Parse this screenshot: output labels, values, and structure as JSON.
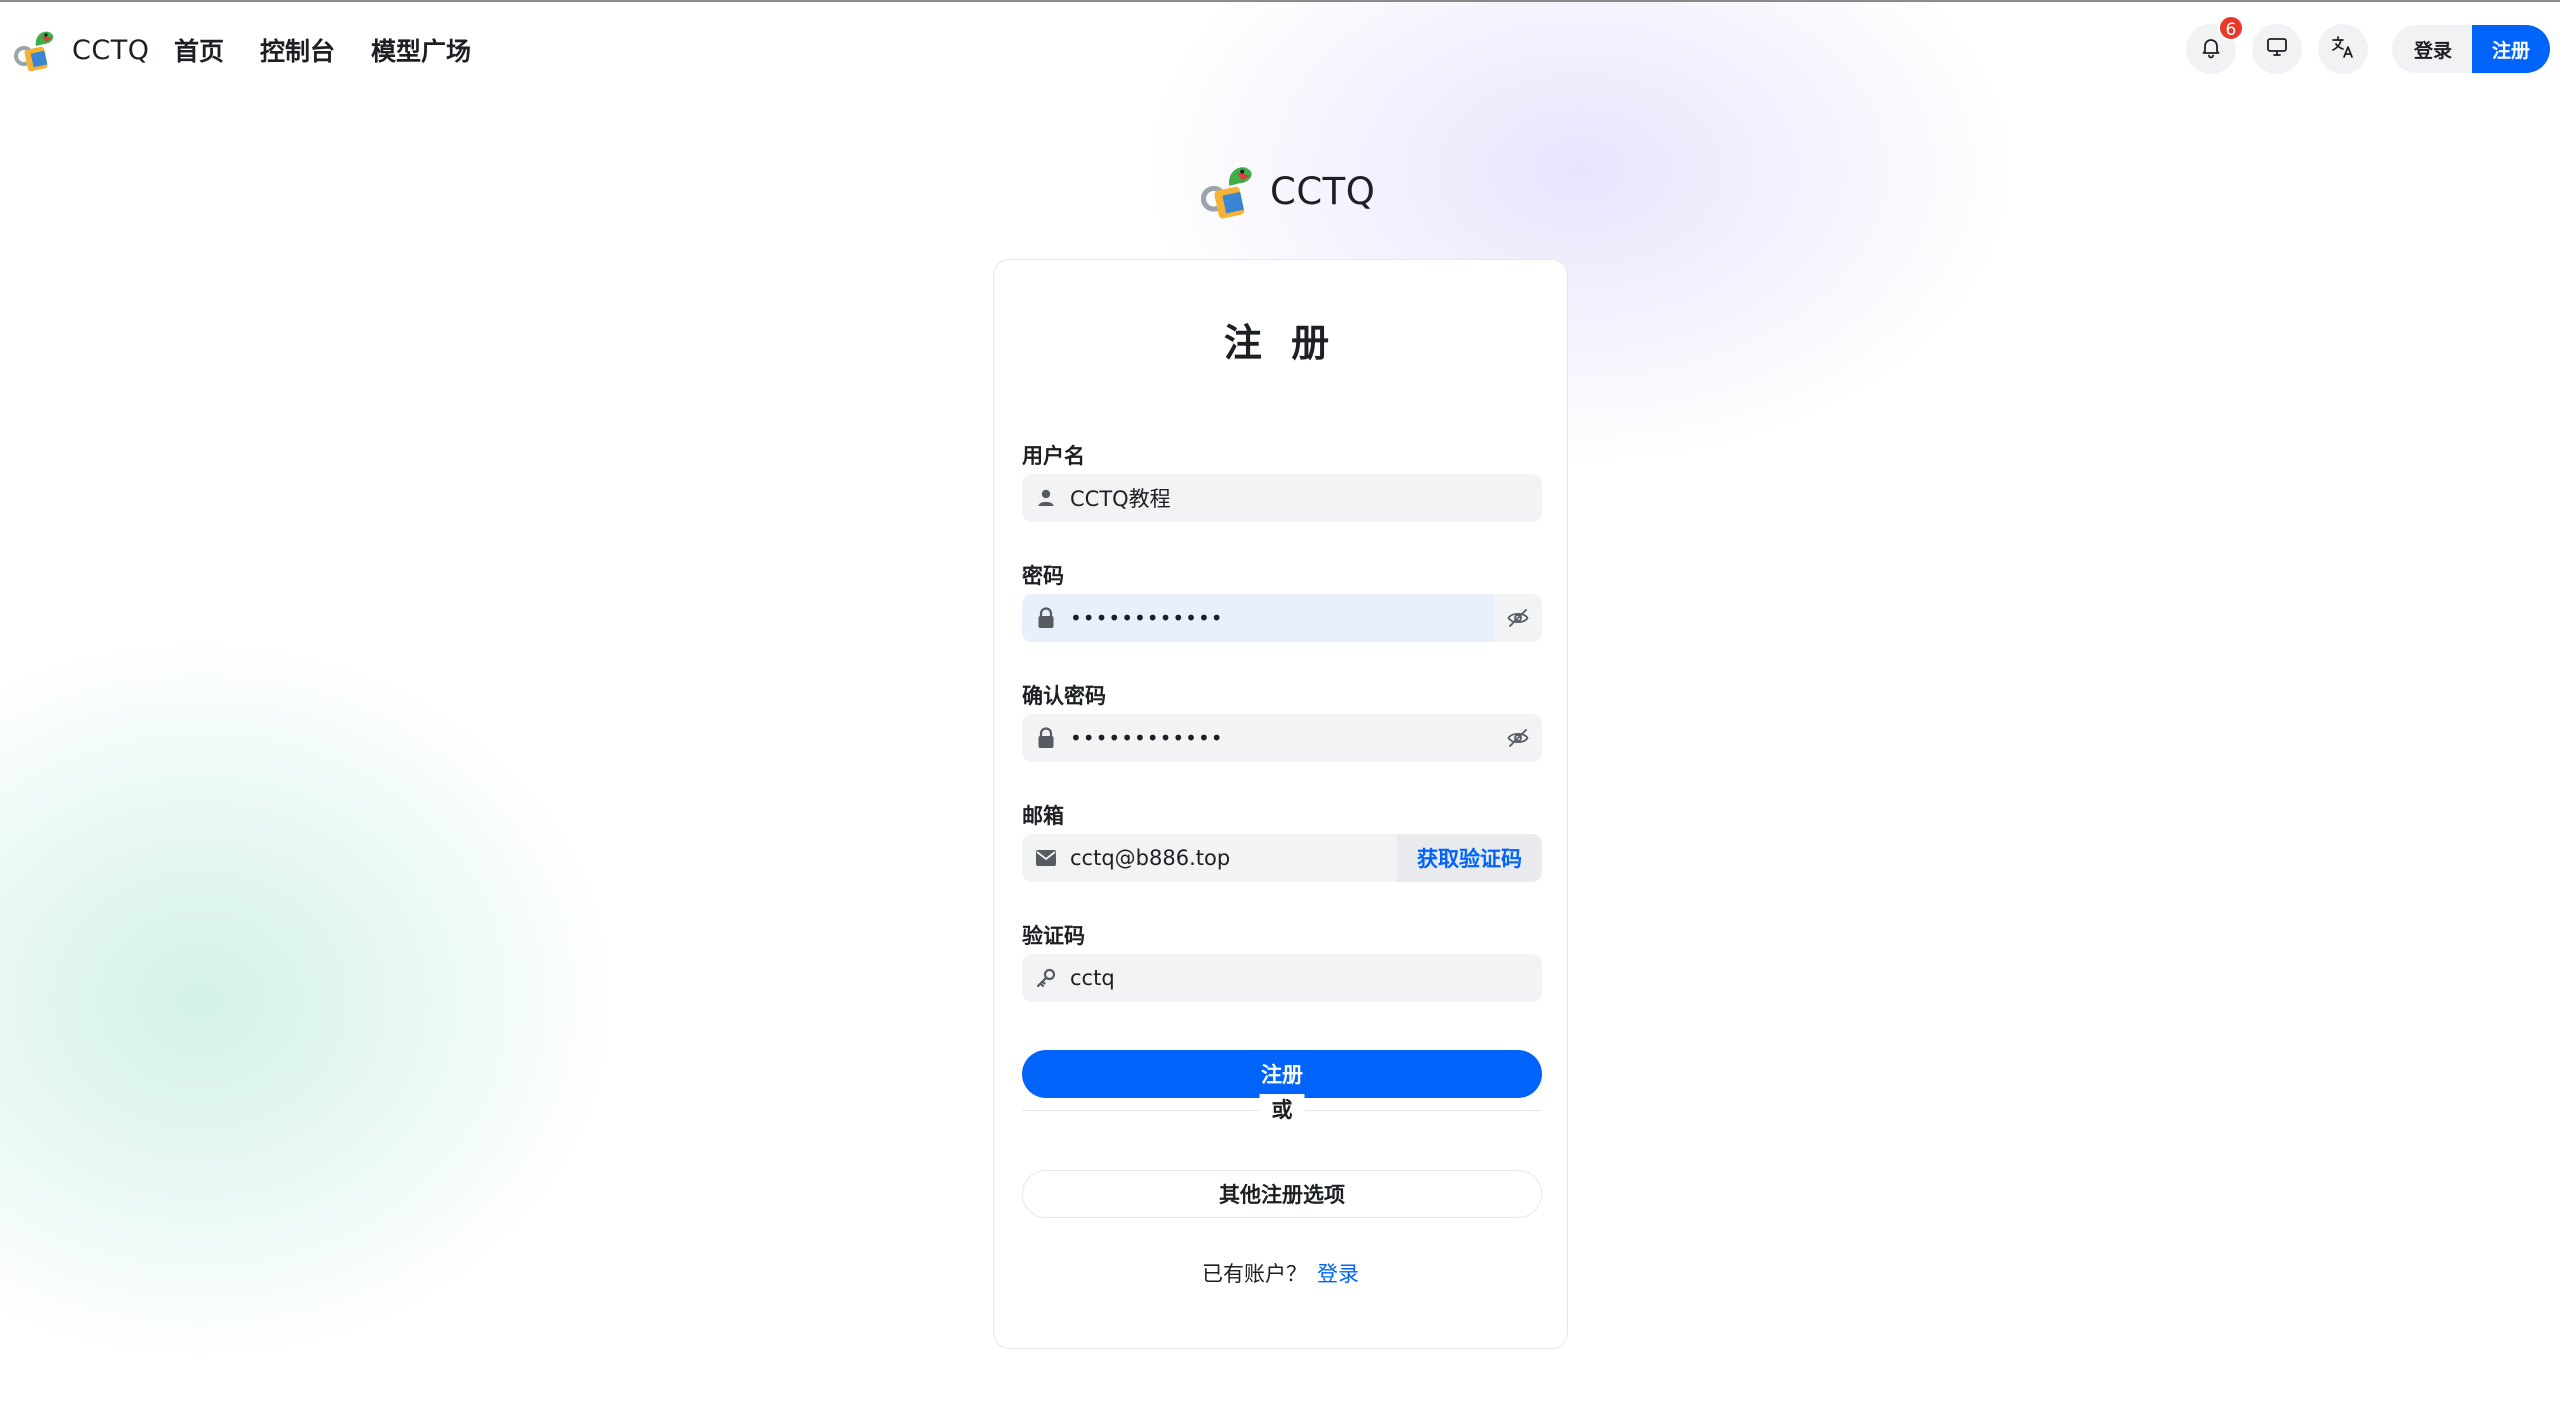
{
  "header": {
    "brand_name": "CCTQ",
    "nav": [
      {
        "label": "首页"
      },
      {
        "label": "控制台"
      },
      {
        "label": "模型广场"
      }
    ],
    "notification_count": "6",
    "login_label": "登录",
    "register_label": "注册",
    "icons": [
      "bell-icon",
      "monitor-icon",
      "translate-icon"
    ]
  },
  "center_brand": {
    "name": "CCTQ"
  },
  "form": {
    "title": "注 册",
    "username": {
      "label": "用户名",
      "value": "CCTQ教程"
    },
    "password": {
      "label": "密码",
      "value": "••••••••••••"
    },
    "confirm_password": {
      "label": "确认密码",
      "value": "••••••••••••"
    },
    "email": {
      "label": "邮箱",
      "value": "cctq@b886.top",
      "code_button": "获取验证码"
    },
    "verification": {
      "label": "验证码",
      "value": "cctq"
    },
    "submit_label": "注册",
    "divider_text": "或",
    "other_options_label": "其他注册选项",
    "have_account_text": "已有账户？",
    "login_link": "登录"
  },
  "colors": {
    "primary": "#0064fa",
    "badge": "#e8392b",
    "input_bg": "#f2f3f5",
    "focused_input_bg": "#e8effd"
  }
}
